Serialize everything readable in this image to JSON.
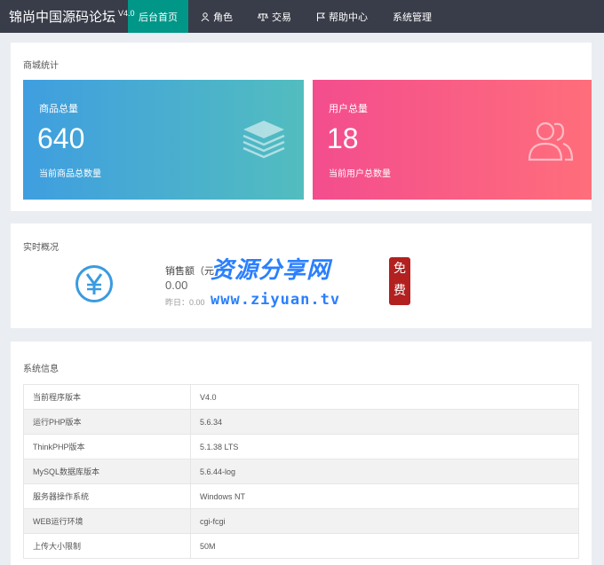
{
  "nav": {
    "brand": "锦尚中国源码论坛",
    "version": "V4.0",
    "items": [
      {
        "label": "后台首页",
        "icon": ""
      },
      {
        "label": "角色",
        "icon": "user-icon"
      },
      {
        "label": "交易",
        "icon": "scale-icon"
      },
      {
        "label": "帮助中心",
        "icon": "flag-icon"
      },
      {
        "label": "系统管理",
        "icon": ""
      }
    ]
  },
  "stats": {
    "title": "商城统计",
    "goods": {
      "label": "商品总量",
      "value": "640",
      "sub": "当前商品总数量",
      "icon": "stack-icon"
    },
    "users": {
      "label": "用户总量",
      "value": "18",
      "sub": "当前用户总数量",
      "icon": "users-icon"
    }
  },
  "realtime": {
    "title": "实时概况",
    "icon": "yen-icon",
    "sales_label": "销售额（元）",
    "sales_value": "0.00",
    "yesterday": "昨日：0.00"
  },
  "watermark": {
    "main": "资源分享网",
    "url": "www.ziyuan.tv",
    "seal": [
      "免",
      "费"
    ]
  },
  "sysinfo": {
    "title": "系统信息",
    "rows": [
      {
        "key": "当前程序版本",
        "value": "V4.0"
      },
      {
        "key": "运行PHP版本",
        "value": "5.6.34"
      },
      {
        "key": "ThinkPHP版本",
        "value": "5.1.38 LTS"
      },
      {
        "key": "MySQL数据库版本",
        "value": "5.6.44-log"
      },
      {
        "key": "服务器操作系统",
        "value": "Windows NT"
      },
      {
        "key": "WEB运行环境",
        "value": "cgi-fcgi"
      },
      {
        "key": "上传大小限制",
        "value": "50M"
      }
    ]
  },
  "colors": {
    "topbar": "#393d49",
    "active_tab": "#009688",
    "goods_card": "#3f9ee0",
    "users_card": "#f34d8e"
  }
}
